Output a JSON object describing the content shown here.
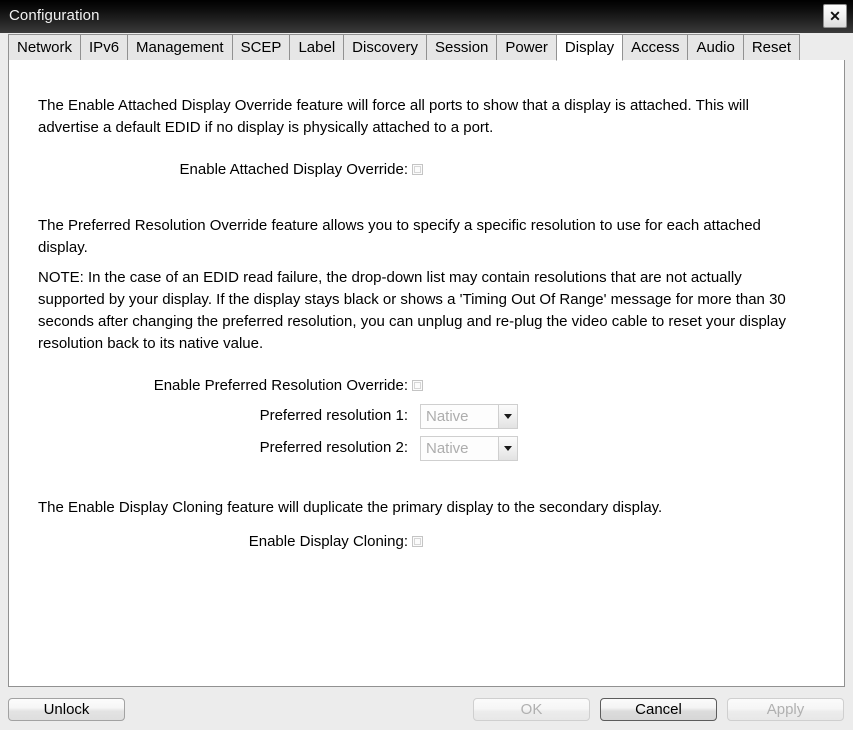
{
  "window": {
    "title": "Configuration",
    "close_label": "✕"
  },
  "tabs": [
    {
      "label": "Network",
      "active": false
    },
    {
      "label": "IPv6",
      "active": false
    },
    {
      "label": "Management",
      "active": false
    },
    {
      "label": "SCEP",
      "active": false
    },
    {
      "label": "Label",
      "active": false
    },
    {
      "label": "Discovery",
      "active": false
    },
    {
      "label": "Session",
      "active": false
    },
    {
      "label": "Power",
      "active": false
    },
    {
      "label": "Display",
      "active": true
    },
    {
      "label": "Access",
      "active": false
    },
    {
      "label": "Audio",
      "active": false
    },
    {
      "label": "Reset",
      "active": false
    }
  ],
  "display_tab": {
    "attached_display_paragraph": "The Enable Attached Display Override feature will force all ports to show that a display is attached. This will advertise a default EDID if no display is physically attached to a port.",
    "attached_display_label": "Enable Attached Display Override:",
    "preferred_resolution_paragraph": "The Preferred Resolution Override feature allows you to specify a specific resolution to use for each attached display.",
    "note_paragraph": "NOTE: In the case of an EDID read failure, the drop-down list may contain resolutions that are not actually supported by your display. If the display stays black or shows a 'Timing Out Of Range' message for more than 30 seconds after changing the preferred resolution, you can unplug and re-plug the video cable to reset your display resolution back to its native value.",
    "preferred_override_label": "Enable Preferred Resolution Override:",
    "preferred_res1_label": "Preferred resolution 1:",
    "preferred_res1_value": "Native",
    "preferred_res2_label": "Preferred resolution 2:",
    "preferred_res2_value": "Native",
    "cloning_paragraph": "The Enable Display Cloning feature will duplicate the primary display to the secondary display.",
    "cloning_label": "Enable Display Cloning:"
  },
  "footer": {
    "unlock_label": "Unlock",
    "ok_label": "OK",
    "cancel_label": "Cancel",
    "apply_label": "Apply"
  },
  "colors": {
    "titlebar_top": "#000000",
    "titlebar_bottom": "#3c3c3c",
    "window_bg": "#ececec",
    "panel_bg": "#ffffff",
    "panel_border": "#919191",
    "tab_inactive_bg": "#e6e6e6",
    "tab_active_bg": "#ffffff",
    "disabled_text": "#b0b0b0"
  }
}
